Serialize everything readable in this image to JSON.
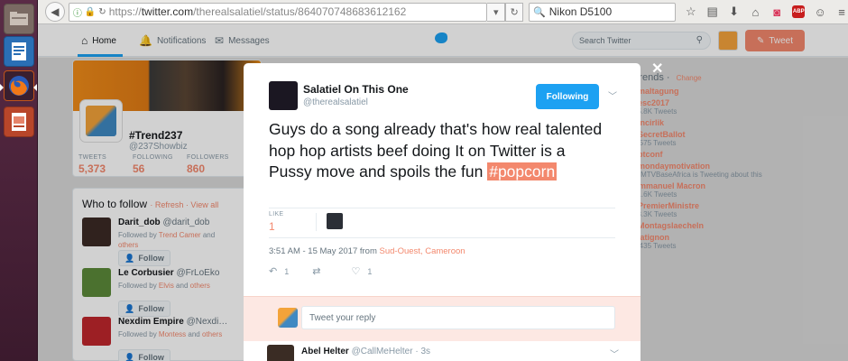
{
  "browser": {
    "url_prefix": "https://",
    "url_host": "twitter.com",
    "url_path": "/therealsalatiel/status/864070748683612162",
    "search_value": "Nikon D5100",
    "abp_label": "ABP"
  },
  "nav": {
    "home": "Home",
    "notifications": "Notifications",
    "messages": "Messages",
    "search_placeholder": "Search Twitter",
    "tweet_button": "Tweet"
  },
  "profile": {
    "name": "#Trend237",
    "handle": "@237Showbiz",
    "stats": [
      {
        "label": "TWEETS",
        "value": "5,373"
      },
      {
        "label": "FOLLOWING",
        "value": "56"
      },
      {
        "label": "FOLLOWERS",
        "value": "860"
      }
    ]
  },
  "who_to_follow": {
    "title": "Who to follow",
    "refresh": "Refresh",
    "view_all": "View all",
    "follow_label": "Follow",
    "followed_by_prefix": "Followed by",
    "others": "others",
    "and": "and",
    "items": [
      {
        "name": "Darit_dob",
        "handle": "@darit_dob",
        "by": "Trend Camer"
      },
      {
        "name": "Le Corbusier",
        "handle": "@FrLoEko",
        "by": "Elvis"
      },
      {
        "name": "Nexdim Empire",
        "handle": "@Nexdi…",
        "by": "Montess"
      }
    ]
  },
  "trends": {
    "title": "Trends",
    "change": "Change",
    "items": [
      {
        "tag": "#maltagung",
        "count": ""
      },
      {
        "tag": "#esc2017",
        "count": "35.8K Tweets"
      },
      {
        "tag": "#Incirlik",
        "count": ""
      },
      {
        "tag": "#SecretBallot",
        "count": "9,575 Tweets"
      },
      {
        "tag": "#btconf",
        "count": ""
      },
      {
        "tag": "#mondaymotivation",
        "count": "@MTVBaseAfrica is Tweeting about this"
      },
      {
        "tag": "Emmanuel Macron",
        "count": "61.6K Tweets"
      },
      {
        "tag": "#PremierMinistre",
        "count": "23.3K Tweets"
      },
      {
        "tag": "#Montagslaecheln",
        "count": ""
      },
      {
        "tag": "Matignon",
        "count": "5,435 Tweets"
      }
    ]
  },
  "tweet": {
    "author_name": "Salatiel On This One",
    "author_handle": "@therealsalatiel",
    "following_label": "Following",
    "text": "Guys do a song already that's how real talented hop hop artists beef doing It on Twitter is a Pussy move and spoils the fun ",
    "hashtag": "#popcorn",
    "likes_label": "LIKE",
    "likes_count": "1",
    "timestamp": "3:51 AM - 15 May 2017 from",
    "location": "Sud-Ouest, Cameroon",
    "reply_count": "1",
    "fav_count": "1",
    "reply_placeholder": "Tweet your reply"
  },
  "reply": {
    "name": "Abel Helter",
    "handle": "@CallMeHelter",
    "time": "3s"
  }
}
